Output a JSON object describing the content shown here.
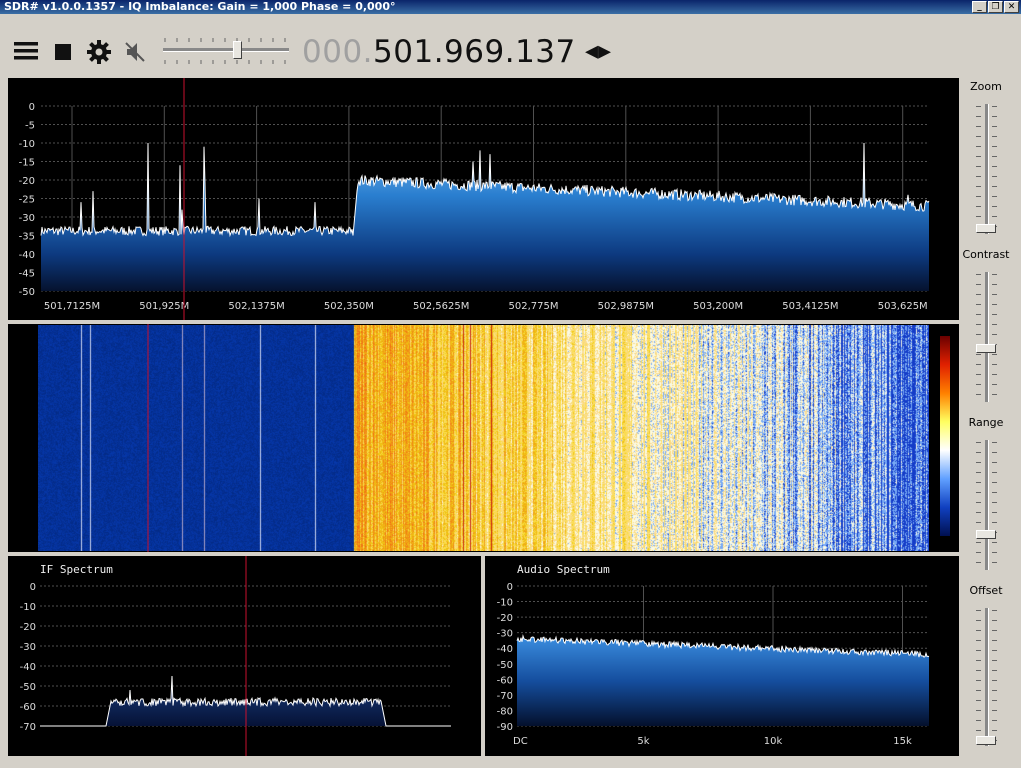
{
  "window": {
    "title": "SDR# v1.0.0.1357 - IQ Imbalance: Gain = 1,000 Phase = 0,000°",
    "buttons": [
      "_",
      "❐",
      "✕"
    ]
  },
  "toolbar": {
    "icons": [
      "menu-icon",
      "stop-icon",
      "gear-icon",
      "mute-icon"
    ],
    "volume_level": 0.6,
    "frequency_dim": "000.",
    "frequency_main": "501.969.137",
    "tune_arrows": "◂▸"
  },
  "main_spectrum": {
    "y_ticks": [
      "0",
      "-5",
      "-10",
      "-15",
      "-20",
      "-25",
      "-30",
      "-35",
      "-40",
      "-45",
      "-50"
    ],
    "x_ticks": [
      "501,7125M",
      "501,925M",
      "502,1375M",
      "502,350M",
      "502,5625M",
      "502,775M",
      "502,9875M",
      "503,200M",
      "503,4125M",
      "503,625M"
    ]
  },
  "if_spectrum": {
    "title": "IF Spectrum",
    "y_ticks": [
      "0",
      "-10",
      "-20",
      "-30",
      "-40",
      "-50",
      "-60",
      "-70"
    ]
  },
  "audio_spectrum": {
    "title": "Audio Spectrum",
    "y_ticks": [
      "0",
      "-10",
      "-20",
      "-30",
      "-40",
      "-50",
      "-60",
      "-70",
      "-80",
      "-90"
    ],
    "x_ticks": [
      "DC",
      "5k",
      "10k",
      "15k"
    ]
  },
  "side_panel": {
    "zoom_label": "Zoom",
    "contrast_label": "Contrast",
    "range_label": "Range",
    "offset_label": "Offset",
    "zoom_level": 0.0,
    "contrast_level": 0.4,
    "range_level": 0.25,
    "offset_level": 0.0
  },
  "colors": {
    "accent_blue": "#1c6fc9",
    "tuning_line": "#c8102e",
    "waterfall_hot": "#f4a020"
  }
}
